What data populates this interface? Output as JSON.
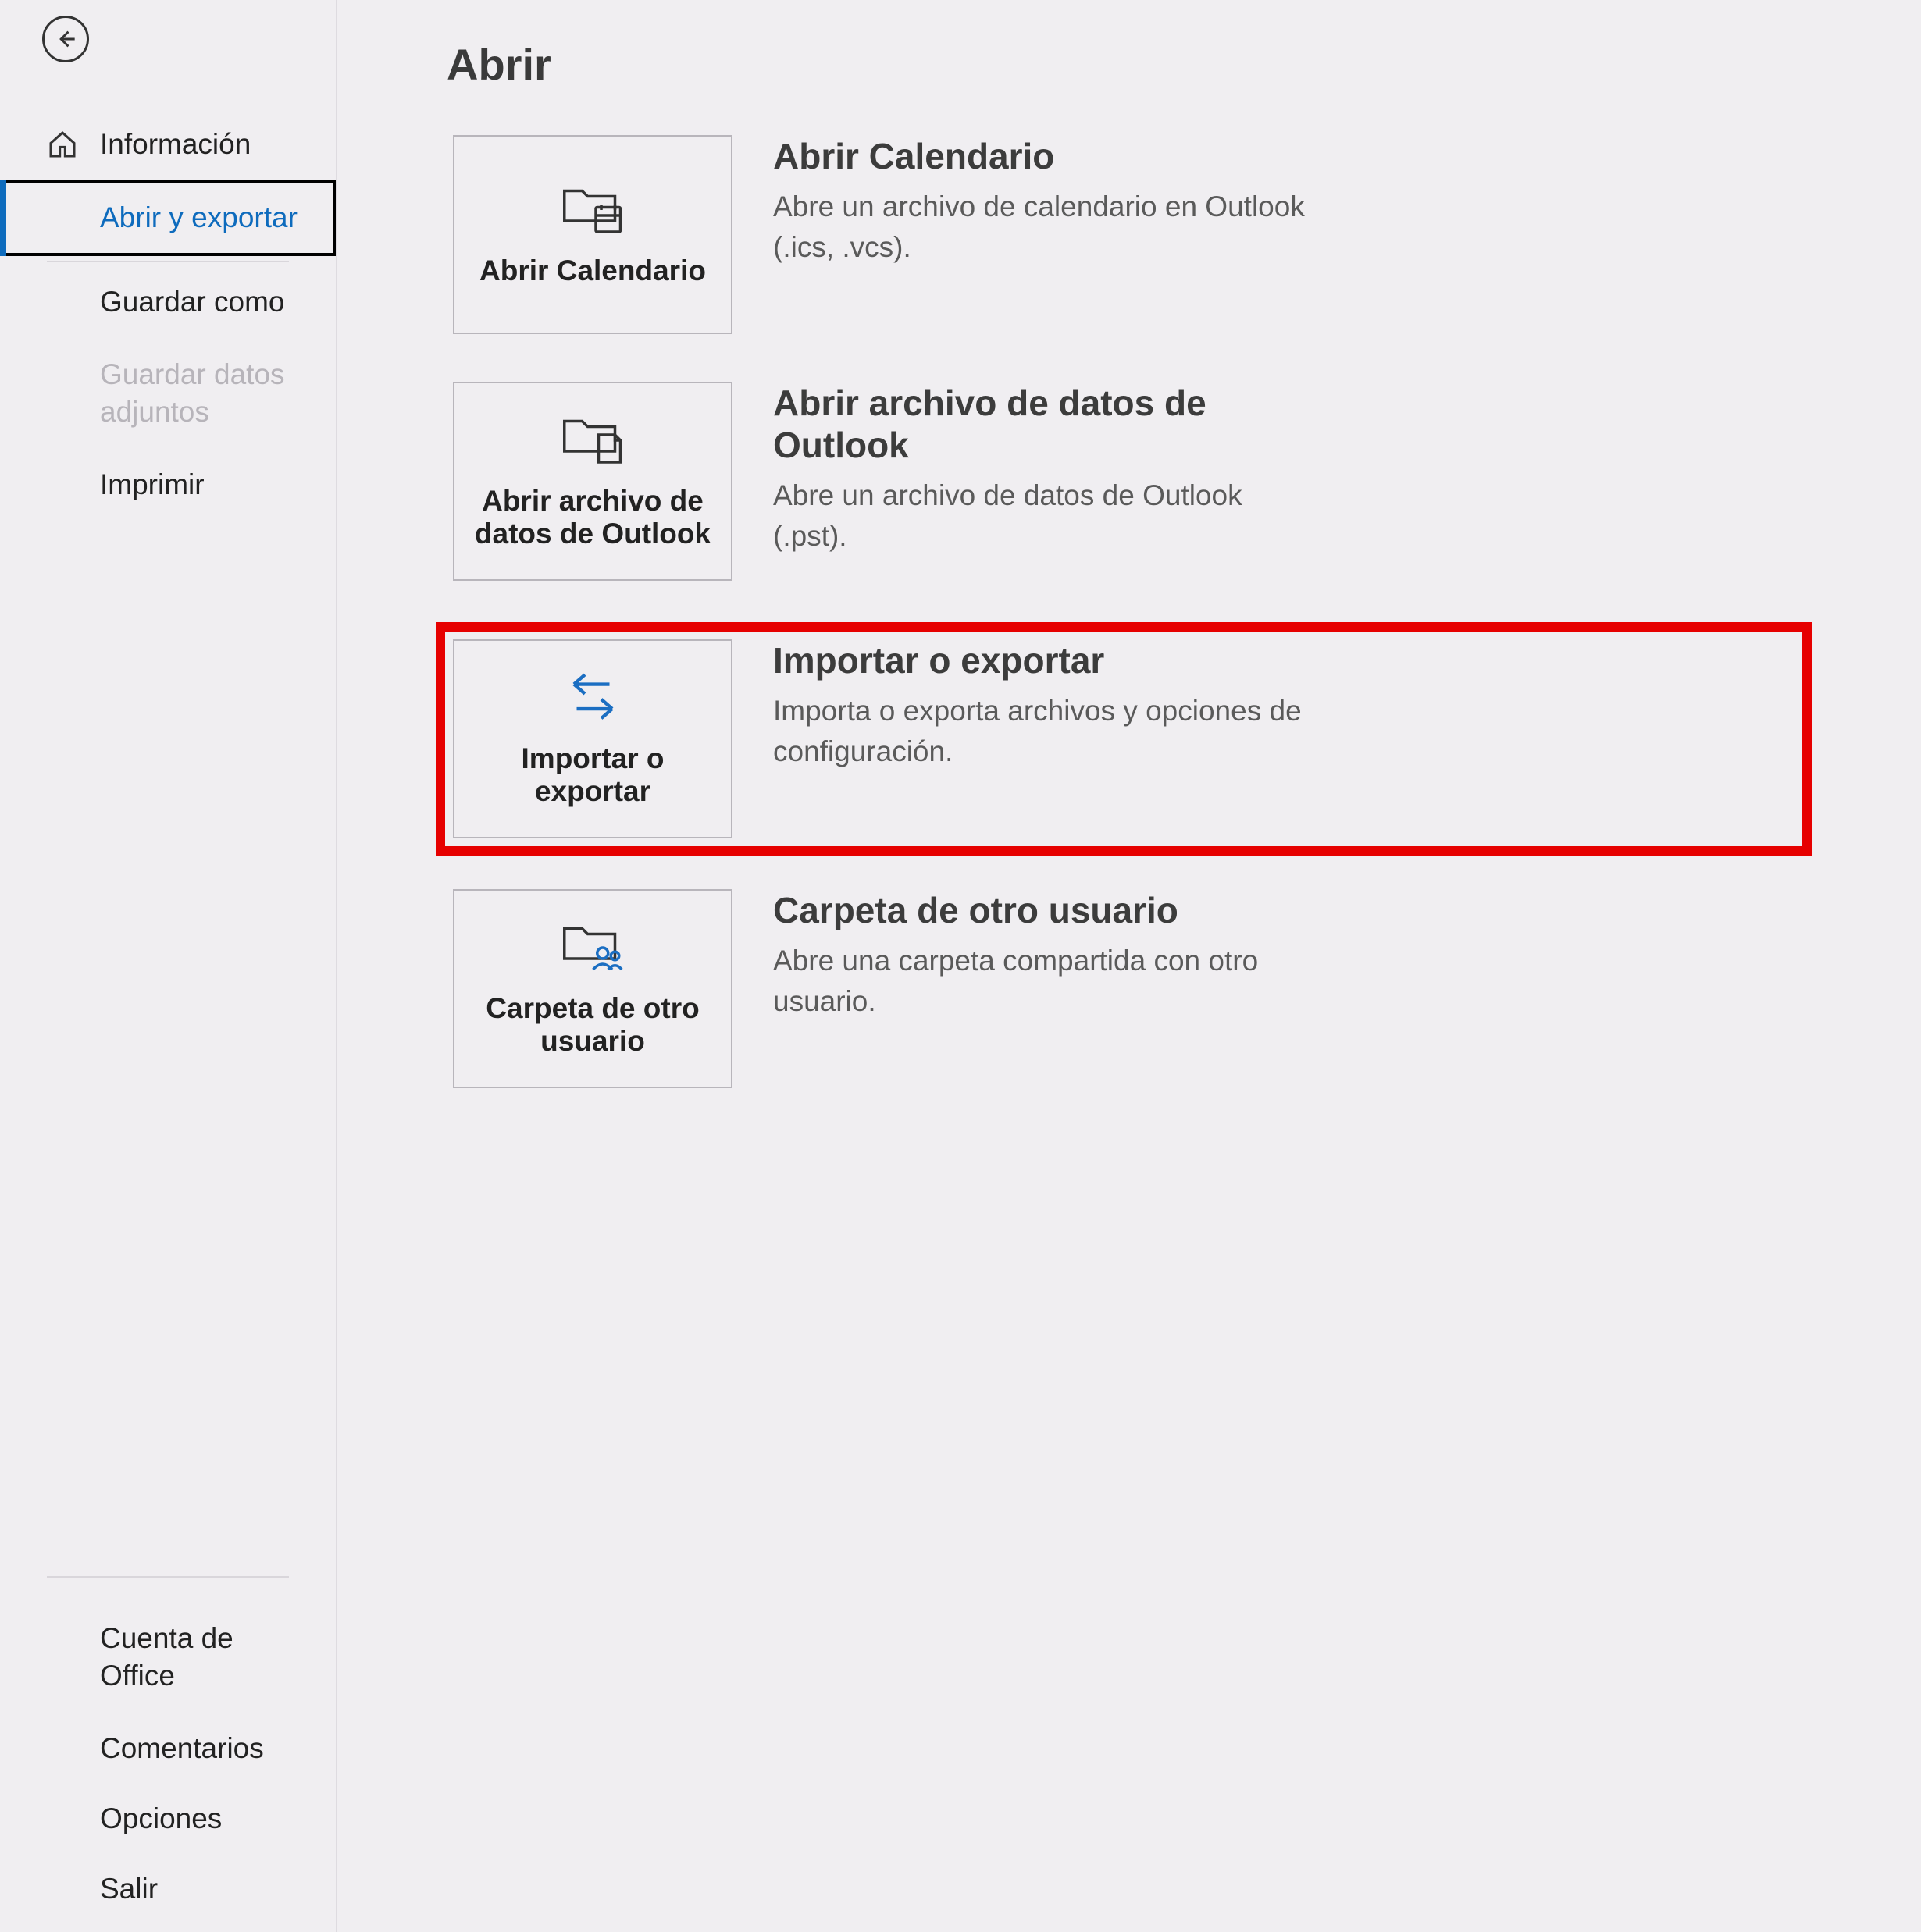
{
  "sidebar": {
    "top": [
      {
        "label": "Información"
      },
      {
        "label": "Abrir y exportar"
      },
      {
        "label": "Guardar como"
      },
      {
        "label": "Guardar datos adjuntos"
      },
      {
        "label": "Imprimir"
      }
    ],
    "bottom": [
      {
        "label": "Cuenta de Office"
      },
      {
        "label": "Comentarios"
      },
      {
        "label": "Opciones"
      },
      {
        "label": "Salir"
      }
    ]
  },
  "page": {
    "title": "Abrir"
  },
  "options": [
    {
      "tile": "Abrir Calendario",
      "title": "Abrir Calendario",
      "desc": "Abre un archivo de calendario en Outlook (.ics, .vcs)."
    },
    {
      "tile": "Abrir archivo de datos de Outlook",
      "title": "Abrir archivo de datos de Outlook",
      "desc": "Abre un archivo de datos de Outlook (.pst)."
    },
    {
      "tile": "Importar o exportar",
      "title": "Importar o exportar",
      "desc": "Importa o exporta archivos y opciones de configuración."
    },
    {
      "tile": "Carpeta de otro usuario",
      "title": "Carpeta de otro usuario",
      "desc": "Abre una carpeta compartida con otro usuario."
    }
  ]
}
